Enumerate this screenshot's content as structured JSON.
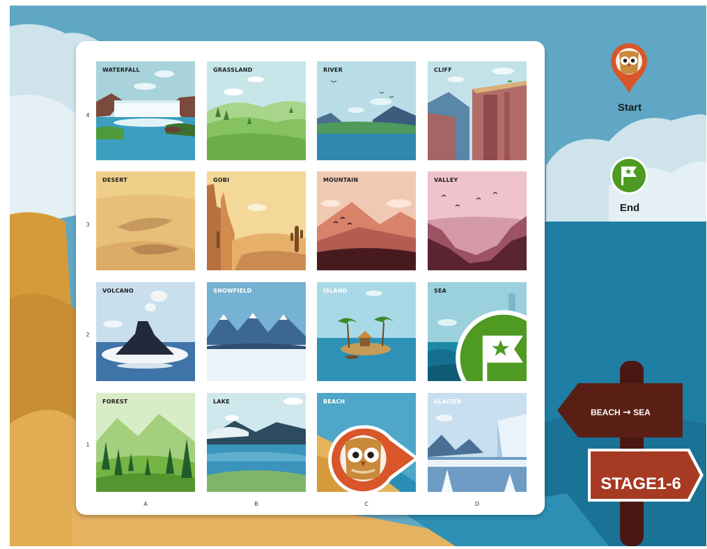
{
  "legend": {
    "start_label": "Start",
    "end_label": "End"
  },
  "grid": {
    "rows": [
      "4",
      "3",
      "2",
      "1"
    ],
    "columns": [
      "A",
      "B",
      "C",
      "D"
    ],
    "tiles": [
      {
        "name": "WATERFALL",
        "col": "A",
        "row": "4"
      },
      {
        "name": "GRASSLAND",
        "col": "B",
        "row": "4"
      },
      {
        "name": "RIVER",
        "col": "C",
        "row": "4"
      },
      {
        "name": "CLIFF",
        "col": "D",
        "row": "4"
      },
      {
        "name": "DESERT",
        "col": "A",
        "row": "3"
      },
      {
        "name": "GOBI",
        "col": "B",
        "row": "3"
      },
      {
        "name": "MOUNTAIN",
        "col": "C",
        "row": "3"
      },
      {
        "name": "VALLEY",
        "col": "D",
        "row": "3"
      },
      {
        "name": "VOLCANO",
        "col": "A",
        "row": "2"
      },
      {
        "name": "SNOWFIELD",
        "col": "B",
        "row": "2"
      },
      {
        "name": "ISLAND",
        "col": "C",
        "row": "2"
      },
      {
        "name": "SEA",
        "col": "D",
        "row": "2"
      },
      {
        "name": "FOREST",
        "col": "A",
        "row": "1"
      },
      {
        "name": "LAKE",
        "col": "B",
        "row": "1"
      },
      {
        "name": "BEACH",
        "col": "C",
        "row": "1"
      },
      {
        "name": "GLACIER",
        "col": "D",
        "row": "1"
      }
    ]
  },
  "route": {
    "from": "BEACH",
    "arrow": "→",
    "to": "SEA"
  },
  "stage": {
    "label": "STAGE1-6"
  },
  "markers": {
    "start_tile": "BEACH",
    "end_tile": "SEA",
    "start_icon": "owl-pin-icon",
    "end_icon": "flag-pin-icon"
  },
  "colors": {
    "sign_brown": "#5a1f14",
    "stage_red": "#a63a22",
    "pin_orange": "#d8562a",
    "flag_green": "#4f9a22"
  }
}
